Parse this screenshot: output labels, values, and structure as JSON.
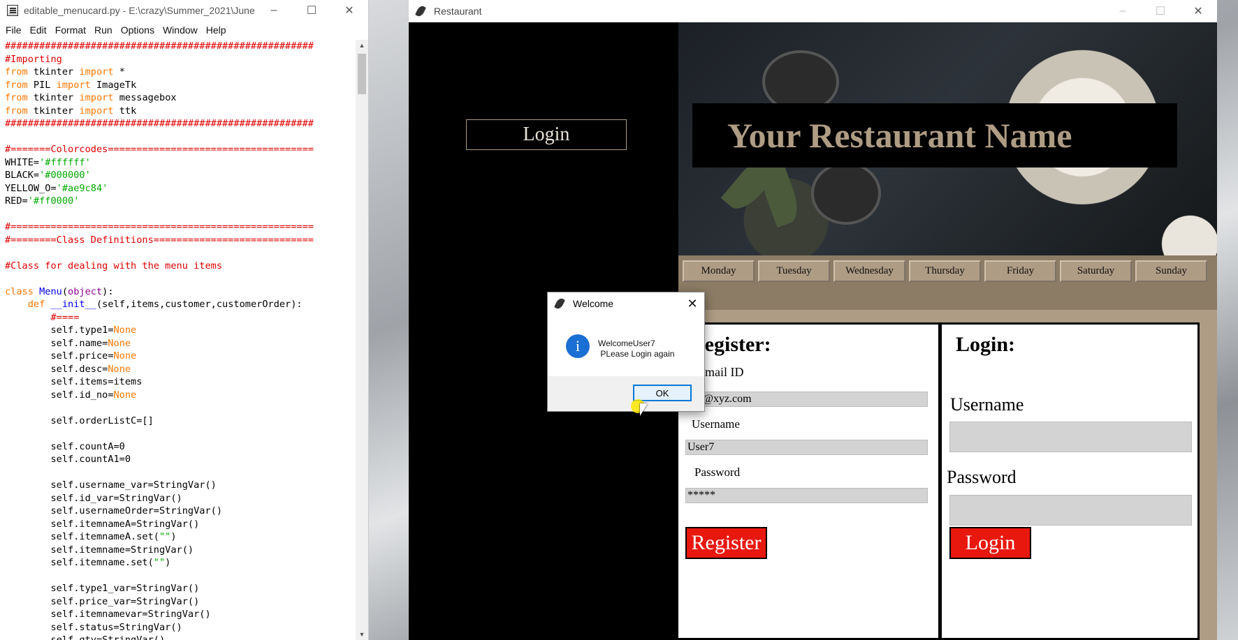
{
  "idle": {
    "title": "editable_menucard.py - E:\\crazy\\Summer_2021\\June...",
    "menu": [
      "File",
      "Edit",
      "Format",
      "Run",
      "Options",
      "Window",
      "Help"
    ],
    "code": [
      {
        "t": "######################################################",
        "c": "red"
      },
      {
        "t": "#Importing",
        "c": "red"
      },
      {
        "parts": [
          [
            "from",
            "orange"
          ],
          [
            " tkinter ",
            ""
          ],
          [
            "import",
            "orange"
          ],
          [
            " *",
            ""
          ]
        ]
      },
      {
        "parts": [
          [
            "from",
            "orange"
          ],
          [
            " PIL ",
            ""
          ],
          [
            "import",
            "orange"
          ],
          [
            " ImageTk",
            ""
          ]
        ]
      },
      {
        "parts": [
          [
            "from",
            "orange"
          ],
          [
            " tkinter ",
            ""
          ],
          [
            "import",
            "orange"
          ],
          [
            " messagebox",
            ""
          ]
        ]
      },
      {
        "parts": [
          [
            "from",
            "orange"
          ],
          [
            " tkinter ",
            ""
          ],
          [
            "import",
            "orange"
          ],
          [
            " ttk",
            ""
          ]
        ]
      },
      {
        "t": "######################################################",
        "c": "red"
      },
      {
        "t": "",
        "c": ""
      },
      {
        "t": "#=======Colorcodes====================================",
        "c": "red"
      },
      {
        "parts": [
          [
            "WHITE=",
            ""
          ],
          [
            "'#ffffff'",
            "green"
          ]
        ]
      },
      {
        "parts": [
          [
            "BLACK=",
            ""
          ],
          [
            "'#000000'",
            "green"
          ]
        ]
      },
      {
        "parts": [
          [
            "YELLOW_O=",
            ""
          ],
          [
            "'#ae9c84'",
            "green"
          ]
        ]
      },
      {
        "parts": [
          [
            "RED=",
            ""
          ],
          [
            "'#ff0000'",
            "green"
          ]
        ]
      },
      {
        "t": "",
        "c": ""
      },
      {
        "t": "#=====================================================",
        "c": "red"
      },
      {
        "t": "#========Class Definitions============================",
        "c": "red"
      },
      {
        "t": "",
        "c": ""
      },
      {
        "t": "#Class for dealing with the menu items",
        "c": "red"
      },
      {
        "t": "",
        "c": ""
      },
      {
        "parts": [
          [
            "class",
            "orange"
          ],
          [
            " ",
            ""
          ],
          [
            "Menu",
            "blue"
          ],
          [
            "(",
            ""
          ],
          [
            "object",
            "purple"
          ],
          [
            "):",
            ""
          ]
        ]
      },
      {
        "parts": [
          [
            "    ",
            ""
          ],
          [
            "def",
            "orange"
          ],
          [
            " ",
            ""
          ],
          [
            "__init__",
            "blue"
          ],
          [
            "(self,items,customer,customerOrder):",
            ""
          ]
        ]
      },
      {
        "t": "        #====",
        "c": "red"
      },
      {
        "parts": [
          [
            "        self.type1=",
            ""
          ],
          [
            "None",
            "orange"
          ]
        ]
      },
      {
        "parts": [
          [
            "        self.name=",
            ""
          ],
          [
            "None",
            "orange"
          ]
        ]
      },
      {
        "parts": [
          [
            "        self.price=",
            ""
          ],
          [
            "None",
            "orange"
          ]
        ]
      },
      {
        "parts": [
          [
            "        self.desc=",
            ""
          ],
          [
            "None",
            "orange"
          ]
        ]
      },
      {
        "t": "        self.items=items",
        "c": ""
      },
      {
        "parts": [
          [
            "        self.id_no=",
            ""
          ],
          [
            "None",
            "orange"
          ]
        ]
      },
      {
        "t": "",
        "c": ""
      },
      {
        "t": "        self.orderListC=[]",
        "c": ""
      },
      {
        "t": "",
        "c": ""
      },
      {
        "t": "        self.countA=0",
        "c": ""
      },
      {
        "t": "        self.countA1=0",
        "c": ""
      },
      {
        "t": "",
        "c": ""
      },
      {
        "t": "        self.username_var=StringVar()",
        "c": ""
      },
      {
        "t": "        self.id_var=StringVar()",
        "c": ""
      },
      {
        "t": "        self.usernameOrder=StringVar()",
        "c": ""
      },
      {
        "t": "        self.itemnameA=StringVar()",
        "c": ""
      },
      {
        "parts": [
          [
            "        self.itemnameA.set(",
            ""
          ],
          [
            "\"\"",
            "green"
          ],
          [
            ")",
            ""
          ]
        ]
      },
      {
        "t": "        self.itemname=StringVar()",
        "c": ""
      },
      {
        "parts": [
          [
            "        self.itemname.set(",
            ""
          ],
          [
            "\"\"",
            "green"
          ],
          [
            ")",
            ""
          ]
        ]
      },
      {
        "t": "",
        "c": ""
      },
      {
        "t": "        self.type1_var=StringVar()",
        "c": ""
      },
      {
        "t": "        self.price_var=StringVar()",
        "c": ""
      },
      {
        "t": "        self.itemnamevar=StringVar()",
        "c": ""
      },
      {
        "t": "        self.status=StringVar()",
        "c": ""
      },
      {
        "t": "        self.qty=StringVar()",
        "c": ""
      }
    ]
  },
  "restaurant": {
    "title": "Restaurant",
    "side_login_label": "Login",
    "banner_text": "Your Restaurant Name",
    "days": [
      "Monday",
      "Tuesday",
      "Wednesday",
      "Thursday",
      "Friday",
      "Saturday",
      "Sunday"
    ],
    "register": {
      "heading": "Register:",
      "email_label": "E-mail ID",
      "email_value": "abc@xyz.com",
      "username_label": "Username",
      "username_value": "User7",
      "password_label": "Password",
      "password_value": "*****",
      "button_label": "Register"
    },
    "login": {
      "heading": "Login:",
      "username_label": "Username",
      "username_value": "",
      "password_label": "Password",
      "password_value": "",
      "button_label": "Login"
    }
  },
  "dialog": {
    "title": "Welcome",
    "line1": "WelcomeUser7",
    "line2": " PLease Login again",
    "ok_label": "OK"
  },
  "colors": {
    "accent": "#ae9c84",
    "button_red": "#e8180f",
    "dialog_blue": "#0078d7"
  }
}
